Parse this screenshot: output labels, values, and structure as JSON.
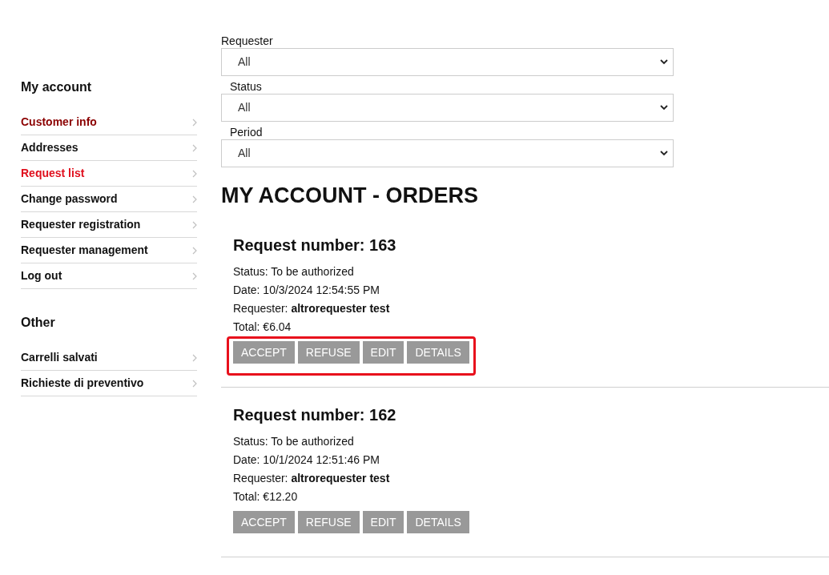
{
  "sidebar": {
    "sections": [
      {
        "title": "My account",
        "items": [
          {
            "label": "Customer info",
            "color": "#8b0000"
          },
          {
            "label": "Addresses",
            "color": "#111111"
          },
          {
            "label": "Request list",
            "color": "#e0101e"
          },
          {
            "label": "Change password",
            "color": "#111111"
          },
          {
            "label": "Requester registration",
            "color": "#111111"
          },
          {
            "label": "Requester management",
            "color": "#111111"
          },
          {
            "label": "Log out",
            "color": "#111111"
          }
        ]
      },
      {
        "title": "Other",
        "items": [
          {
            "label": "Carrelli salvati",
            "color": "#111111"
          },
          {
            "label": "Richieste di preventivo",
            "color": "#111111"
          }
        ]
      }
    ]
  },
  "filters": [
    {
      "label": "Requester",
      "value": "All"
    },
    {
      "label": "Status",
      "value": "All"
    },
    {
      "label": "Period",
      "value": "All"
    }
  ],
  "heading": "MY ACCOUNT - ORDERS",
  "requests": [
    {
      "title": "Request number: 163",
      "status": "Status: To be authorized",
      "date": "Date: 10/3/2024 12:54:55 PM",
      "requester": "Requester: **altrorequester test**",
      "total": "Total: €6.04",
      "highlighted": true,
      "buttons": [
        "ACCEPT",
        "REFUSE",
        "EDIT",
        "DETAILS"
      ]
    },
    {
      "title": "Request number: 162",
      "status": "Status: To be authorized",
      "date": "Date: 10/1/2024 12:51:46 PM",
      "requester": "Requester: **altrorequester test**",
      "total": "Total: €12.20",
      "highlighted": false,
      "buttons": [
        "ACCEPT",
        "REFUSE",
        "EDIT",
        "DETAILS"
      ]
    }
  ]
}
